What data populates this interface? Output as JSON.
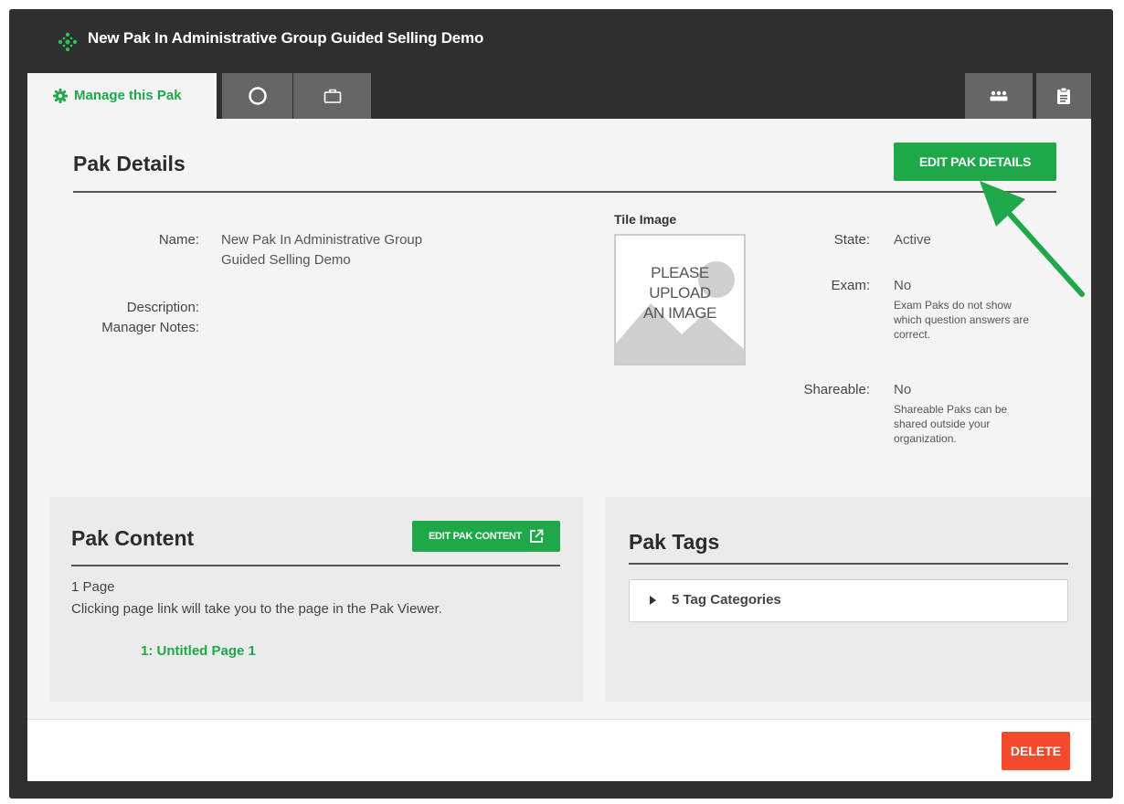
{
  "window": {
    "title": "New Pak In Administrative Group Guided Selling Demo"
  },
  "tabs": {
    "manage_label": "Manage this Pak"
  },
  "details": {
    "heading": "Pak Details",
    "edit_button": "EDIT PAK DETAILS",
    "name_label": "Name:",
    "name_line1": "New Pak In Administrative Group",
    "name_line2": "Guided Selling Demo",
    "description_label": "Description:",
    "manager_notes_label": "Manager Notes:",
    "tile_label": "Tile Image",
    "tile_placeholder": [
      "PLEASE",
      "UPLOAD",
      "AN IMAGE"
    ],
    "state_label": "State:",
    "state_value": "Active",
    "exam_label": "Exam:",
    "exam_value": "No",
    "exam_note": [
      "Exam Paks do not show",
      "which question answers are",
      "correct."
    ],
    "shareable_label": "Shareable:",
    "shareable_value": "No",
    "shareable_note": [
      "Shareable Paks can be",
      "shared outside your",
      "organization."
    ]
  },
  "content": {
    "heading": "Pak Content",
    "edit_button": "EDIT PAK CONTENT",
    "page_count": "1 Page",
    "hint": "Clicking page link will take you to the page in the Pak Viewer.",
    "page_link": "1: Untitled Page 1"
  },
  "tags": {
    "heading": "Pak Tags",
    "categories": "5 Tag Categories"
  },
  "footer": {
    "delete_button": "DELETE"
  },
  "colors": {
    "accent_green": "#1ea84a",
    "delete_red": "#f24a2a",
    "frame_dark": "#2f2f2f",
    "tab_gray": "#666666"
  }
}
